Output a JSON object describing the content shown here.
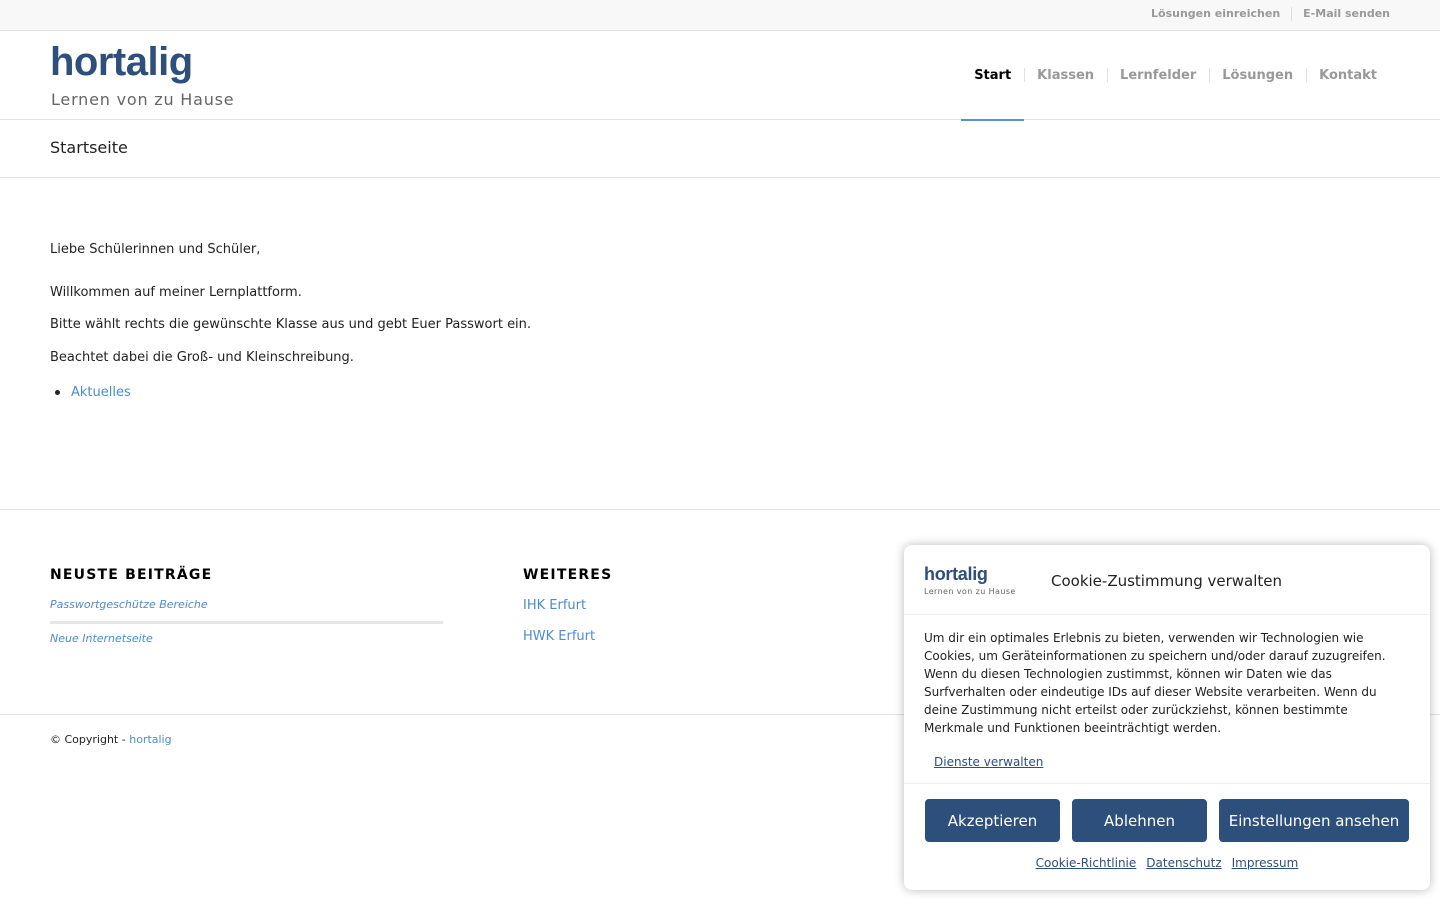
{
  "topbar": {
    "links": [
      "Lösungen einreichen",
      "E-Mail senden"
    ]
  },
  "header": {
    "logo_main": "hortalig",
    "logo_sub": "Lernen von zu Hause",
    "nav": [
      "Start",
      "Klassen",
      "Lernfelder",
      "Lösungen",
      "Kontakt"
    ],
    "active_nav": "Start",
    "accent_color": "#5b8fcf"
  },
  "page_title": "Startseite",
  "content": {
    "greeting": "Liebe Schülerinnen und Schüler,",
    "line1": "Willkommen auf meiner Lernplattform.",
    "line2": "Bitte wählt rechts die gewünschte Klasse aus und gebt Euer Passwort ein.",
    "line3": "Beachtet dabei die Groß- und Kleinschreibung.",
    "list": [
      "Aktuelles"
    ]
  },
  "footer": {
    "col1_title": "NEUSTE BEITRÄGE",
    "posts": [
      "Passwortgeschütze Bereiche",
      "Neue Internetseite"
    ],
    "col2_title": "WEITERES",
    "links": [
      "IHK Erfurt",
      "HWK Erfurt"
    ]
  },
  "copyright": {
    "prefix": "© Copyright - ",
    "link": "hortalig"
  },
  "cookie": {
    "logo_main": "hortalig",
    "logo_sub": "Lernen von zu Hause",
    "title": "Cookie-Zustimmung verwalten",
    "text": "Um dir ein optimales Erlebnis zu bieten, verwenden wir Technologien wie Cookies, um Geräteinformationen zu speichern und/oder darauf zuzugreifen. Wenn du diesen Technologien zustimmst, können wir Daten wie das Surfverhalten oder eindeutige IDs auf dieser Website verarbeiten. Wenn du deine Zustimmung nicht erteilst oder zurückziehst, können bestimmte Merkmale und Funktionen beeinträchtigt werden.",
    "manage": "Dienste verwalten",
    "accept": "Akzeptieren",
    "deny": "Ablehnen",
    "settings": "Einstellungen ansehen",
    "links": [
      "Cookie-Richtlinie",
      "Datenschutz",
      "Impressum"
    ],
    "button_color": "#2c4f7c"
  }
}
